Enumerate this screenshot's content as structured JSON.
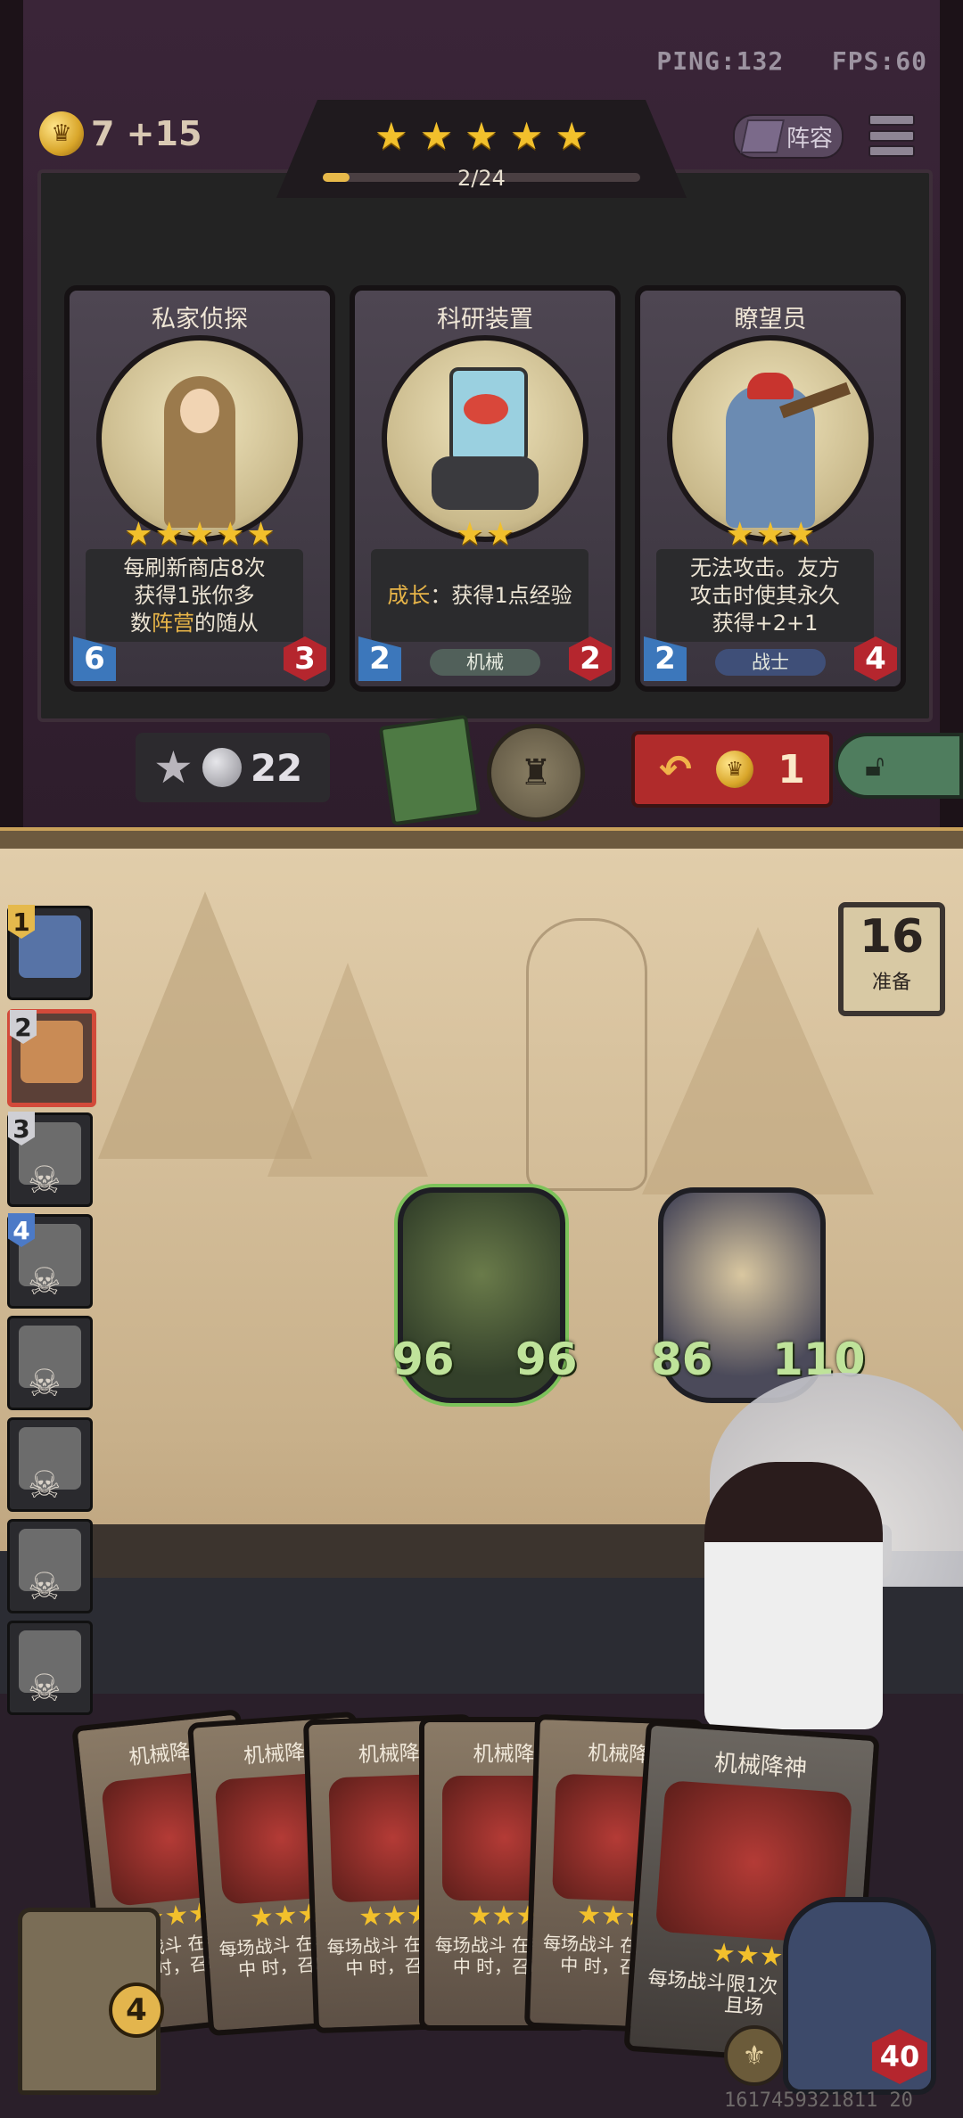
{
  "status": {
    "ping": "PING:132",
    "fps": "FPS:60"
  },
  "gold": {
    "text": "7 +15"
  },
  "lineup_button": {
    "label": "阵容"
  },
  "tavern": {
    "tier_progress": "2/24",
    "stars": 5,
    "progress_fraction": 0.083
  },
  "shop": {
    "cards": [
      {
        "name": "私家侦探",
        "stars": 5,
        "desc_lines": [
          "每刷新商店8次",
          "获得1张你多"
        ],
        "desc_last_pre": "数",
        "desc_last_hl": "阵营",
        "desc_last_post": "的随从",
        "attack": "6",
        "health": "3",
        "tribe": ""
      },
      {
        "name": "科研装置",
        "stars": 2,
        "desc_hl": "成长",
        "desc_rest": "：获得1点经验",
        "attack": "2",
        "health": "2",
        "tribe": "机械"
      },
      {
        "name": "瞭望员",
        "stars": 3,
        "desc_lines": [
          "无法攻击。友方",
          "攻击时使其永久",
          "获得+2+1"
        ],
        "attack": "2",
        "health": "4",
        "tribe": "战士"
      }
    ]
  },
  "controls": {
    "upgrade_cost": "22",
    "refresh_cost": "1"
  },
  "ready": {
    "count": "16",
    "label": "准备"
  },
  "players": [
    {
      "rank": "1",
      "state": "alive"
    },
    {
      "rank": "2",
      "state": "active"
    },
    {
      "rank": "3",
      "state": "dead"
    },
    {
      "rank": "4",
      "state": "dead"
    },
    {
      "rank": "",
      "state": "dead"
    },
    {
      "rank": "",
      "state": "dead"
    },
    {
      "rank": "",
      "state": "dead"
    },
    {
      "rank": "",
      "state": "dead"
    }
  ],
  "board_minions": [
    {
      "name": "pumpkin",
      "attack": "96",
      "health": "96"
    },
    {
      "name": "clock",
      "attack": "86",
      "health": "110"
    }
  ],
  "hand": [
    {
      "name": "机械降",
      "desc": "每场战斗 在手牌中 时，召唤"
    },
    {
      "name": "机械降",
      "desc": "每场战斗 在手牌中 时，召唤"
    },
    {
      "name": "机械降",
      "desc": "每场战斗 在手牌中 时，召唤"
    },
    {
      "name": "机械降",
      "desc": "每场战斗 在手牌中 时，召唤"
    },
    {
      "name": "机械降",
      "desc": "每场战斗 在手牌中 时，召唤"
    },
    {
      "name": "机械降神",
      "desc": "每场战斗限1次 手牌中且场"
    }
  ],
  "hand_count": "4",
  "hero": {
    "health": "40"
  },
  "footer_id": "1617459321811 20"
}
